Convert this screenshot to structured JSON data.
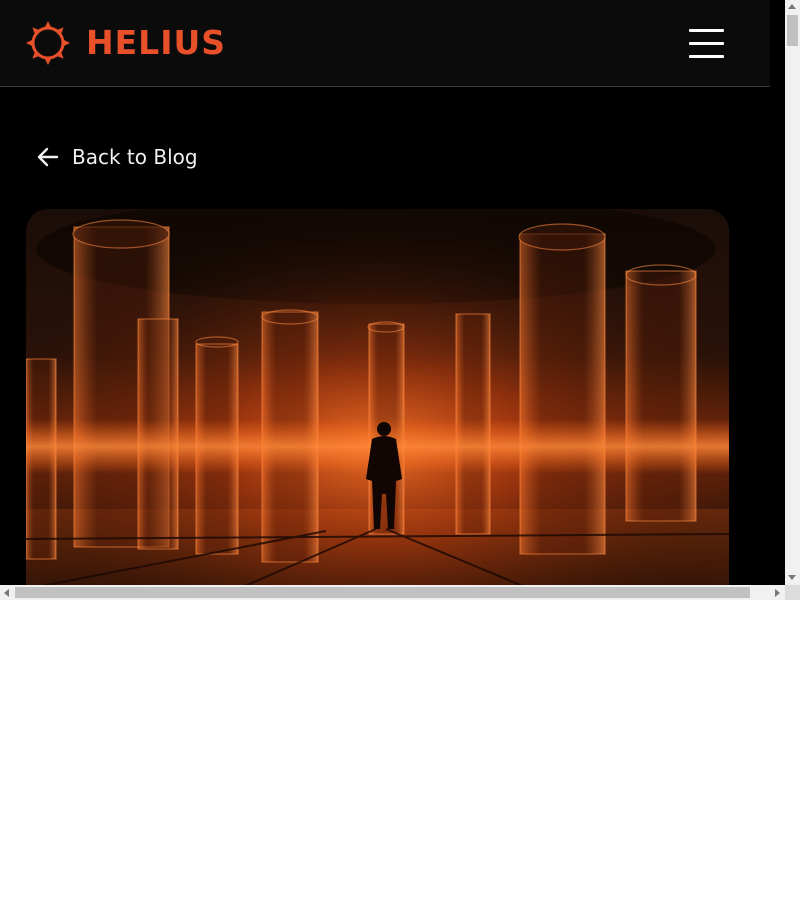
{
  "header": {
    "brand_name": "HELIUS",
    "logo_icon": "helius-sun-icon",
    "menu_icon": "hamburger-menu-icon",
    "brand_color": "#e8502a"
  },
  "nav": {
    "back_label": "Back to Blog",
    "back_icon": "arrow-left-icon"
  },
  "hero": {
    "image_description_icon": "glowing-cylinders-hero-image"
  }
}
